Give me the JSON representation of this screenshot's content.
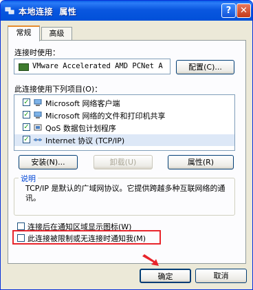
{
  "window": {
    "title": "本地连接  属性"
  },
  "tabs": [
    {
      "label": "常规"
    },
    {
      "label": "高级"
    }
  ],
  "connect_using": {
    "label": "连接时使用：",
    "device": "VMware Accelerated AMD PCNet A",
    "configure_button": "配置(C)..."
  },
  "items_section": {
    "label": "此连接使用下列项目(O)：",
    "items": [
      {
        "label": "Microsoft 网络客户端",
        "checked": true
      },
      {
        "label": "Microsoft 网络的文件和打印机共享",
        "checked": true
      },
      {
        "label": "QoS 数据包计划程序",
        "checked": true
      },
      {
        "label": "Internet 协议 (TCP/IP)",
        "checked": true
      }
    ]
  },
  "buttons": {
    "install": "安装(N)...",
    "uninstall": "卸载(U)",
    "properties": "属性(R)"
  },
  "description": {
    "title": "说明",
    "text": "TCP/IP 是默认的广域网协议。它提供跨越多种互联网络的通讯。"
  },
  "options": {
    "show_icon": "连接后在通知区域显示图标(W)",
    "notify_limited": "此连接被限制或无连接时通知我(M)"
  },
  "footer": {
    "ok": "确定",
    "cancel": "取消"
  },
  "colors": {
    "titlebar": "#0a57e0",
    "highlight_box": "#e8242b",
    "arrow": "#e8242b"
  }
}
